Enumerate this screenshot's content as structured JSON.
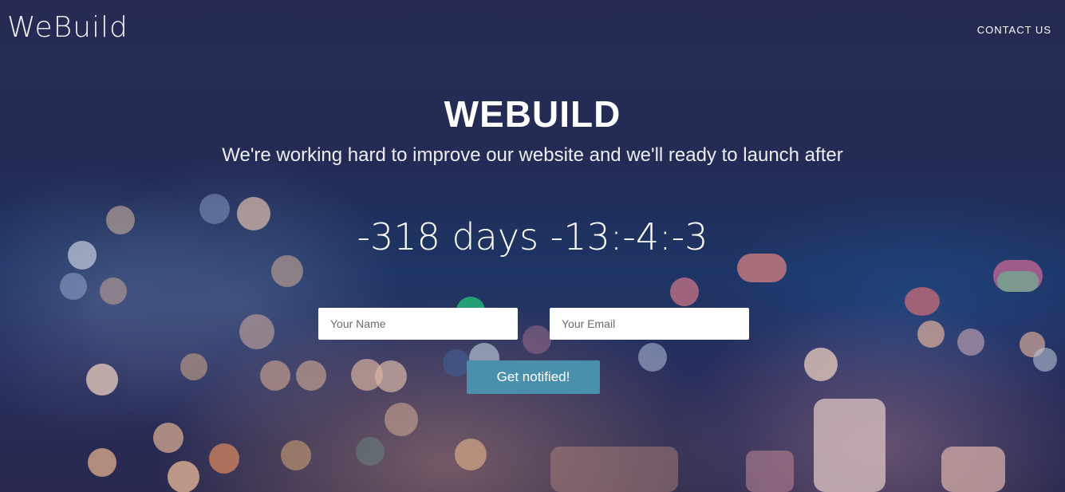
{
  "header": {
    "logo": "WeBuild",
    "nav_contact": "CONTACT US"
  },
  "hero": {
    "title": "WEBUILD",
    "subtitle": "We're working hard to improve our website and we'll ready to launch after",
    "countdown": "-318 days -13:-4:-3"
  },
  "form": {
    "name_placeholder": "Your Name",
    "email_placeholder": "Your Email",
    "submit_label": "Get notified!"
  },
  "colors": {
    "background": "#262f57",
    "button": "#4a90ad",
    "text": "#ffffff"
  }
}
